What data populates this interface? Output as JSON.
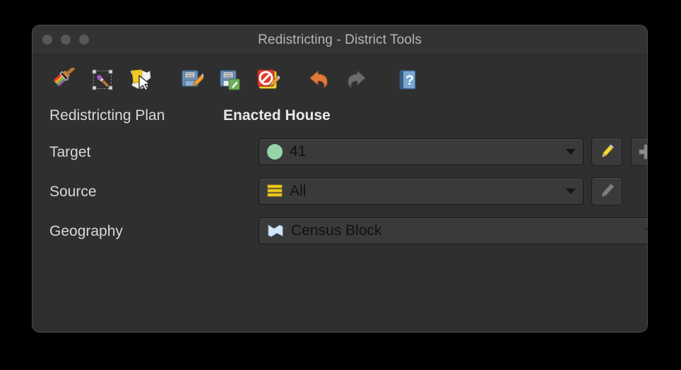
{
  "window": {
    "title": "Redistricting - District Tools",
    "traffic_lights": [
      "close",
      "minimize",
      "maximize"
    ]
  },
  "toolbar": {
    "items": [
      {
        "name": "paint-districts-icon",
        "label": "Paint Districts",
        "enabled": true
      },
      {
        "name": "paint-rectangle-icon",
        "label": "Paint Rectangle",
        "enabled": true
      },
      {
        "name": "select-features-icon",
        "label": "Select Features",
        "enabled": true
      },
      {
        "name": "edit-assignments-icon",
        "label": "Edit Assignments",
        "enabled": true
      },
      {
        "name": "commit-assignments-icon",
        "label": "Commit Assignments",
        "enabled": true
      },
      {
        "name": "discard-assignments-icon",
        "label": "Discard Assignments",
        "enabled": true
      },
      {
        "name": "undo-icon",
        "label": "Undo",
        "enabled": true
      },
      {
        "name": "redo-icon",
        "label": "Redo",
        "enabled": false
      },
      {
        "name": "help-icon",
        "label": "Help",
        "enabled": true
      }
    ]
  },
  "form": {
    "plan": {
      "label": "Redistricting Plan",
      "value": "Enacted House"
    },
    "target": {
      "label": "Target",
      "value": "41",
      "swatch_color": "#95d5a8",
      "edit_button": "Edit District",
      "add_button": "Add District",
      "edit_enabled": true,
      "add_enabled": true
    },
    "source": {
      "label": "Source",
      "value": "All",
      "swatch_color": "#f2cc24",
      "edit_button": "Edit Source",
      "edit_enabled": false
    },
    "geography": {
      "label": "Geography",
      "value": "Census Block",
      "swatch_color": "#cfe4f5"
    }
  },
  "colors": {
    "window_bg": "#2f2f2f",
    "titlebar_bg": "#333333",
    "label_text": "#d8d8d8",
    "combo_bg": "#3a3a3a",
    "combo_text": "#111111",
    "accent_orange": "#e07b39"
  }
}
